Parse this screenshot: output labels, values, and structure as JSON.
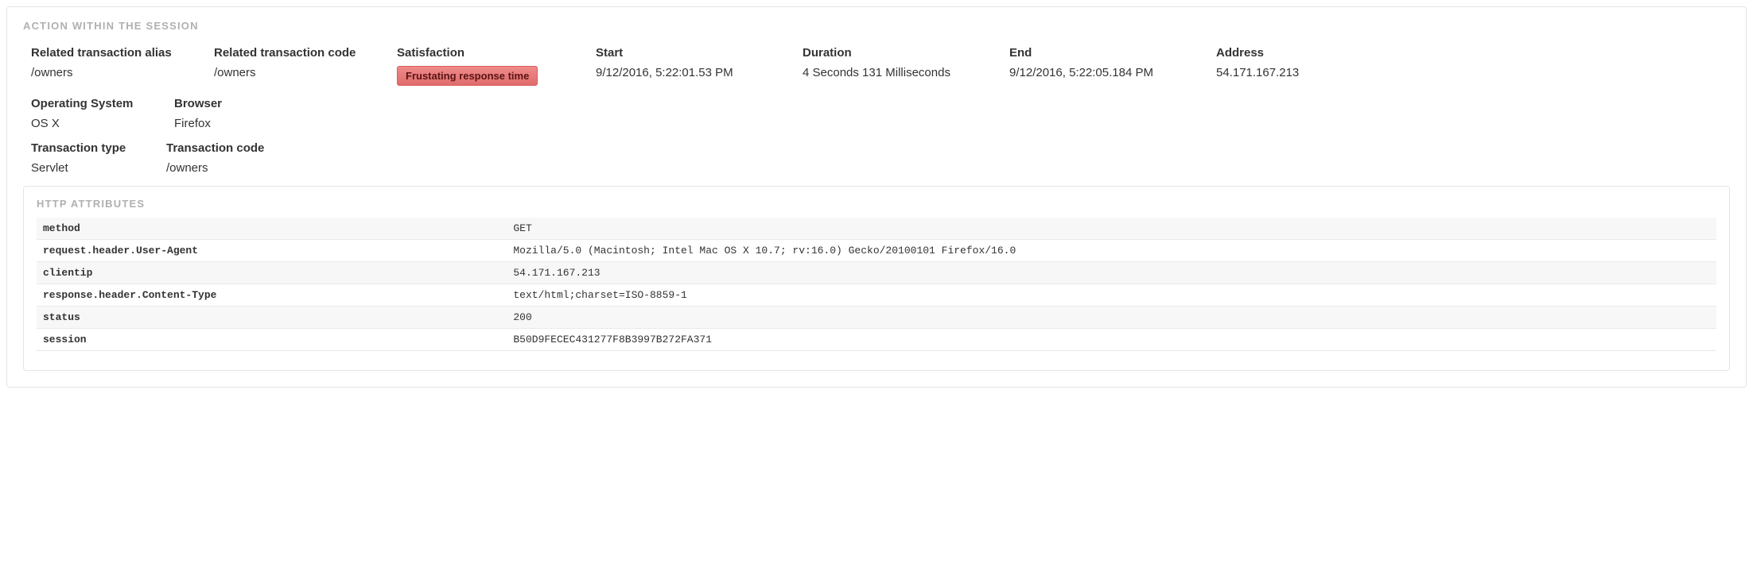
{
  "section": {
    "title": "ACTION WITHIN THE SESSION",
    "row1": {
      "related_alias": {
        "label": "Related transaction alias",
        "value": "/owners"
      },
      "related_code": {
        "label": "Related transaction code",
        "value": "/owners"
      },
      "satisfaction": {
        "label": "Satisfaction",
        "badge": "Frustating response time"
      },
      "start": {
        "label": "Start",
        "value": "9/12/2016, 5:22:01.53 PM"
      },
      "duration": {
        "label": "Duration",
        "value": "4 Seconds 131 Milliseconds"
      },
      "end": {
        "label": "End",
        "value": "9/12/2016, 5:22:05.184 PM"
      },
      "address": {
        "label": "Address",
        "value": "54.171.167.213"
      }
    },
    "row2": {
      "os": {
        "label": "Operating System",
        "value": "OS X"
      },
      "browser": {
        "label": "Browser",
        "value": "Firefox"
      }
    },
    "row3": {
      "tx_type": {
        "label": "Transaction type",
        "value": "Servlet"
      },
      "tx_code": {
        "label": "Transaction code",
        "value": "/owners"
      }
    }
  },
  "http": {
    "title": "HTTP ATTRIBUTES",
    "rows": [
      {
        "key": "method",
        "value": "GET"
      },
      {
        "key": "request.header.User-Agent",
        "value": "Mozilla/5.0 (Macintosh; Intel Mac OS X 10.7; rv:16.0) Gecko/20100101 Firefox/16.0"
      },
      {
        "key": "clientip",
        "value": "54.171.167.213"
      },
      {
        "key": "response.header.Content-Type",
        "value": "text/html;charset=ISO-8859-1"
      },
      {
        "key": "status",
        "value": "200"
      },
      {
        "key": "session",
        "value": "B50D9FECEC431277F8B3997B272FA371"
      }
    ]
  }
}
